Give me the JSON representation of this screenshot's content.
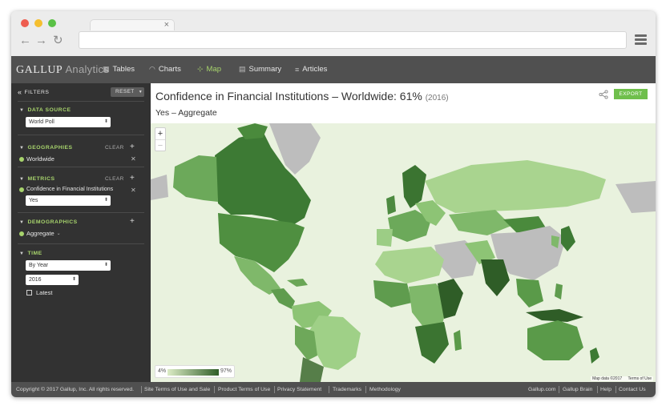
{
  "browser": {
    "tab_close": "×",
    "nav": {
      "back": "←",
      "forward": "→",
      "reload": "↻"
    }
  },
  "app": {
    "logo_brand": "GALLUP",
    "logo_sub": "Analytics",
    "nav_items": [
      {
        "label": "Tables",
        "icon": "table-icon"
      },
      {
        "label": "Charts",
        "icon": "chart-icon"
      },
      {
        "label": "Map",
        "icon": "map-icon",
        "active": true
      },
      {
        "label": "Summary",
        "icon": "summary-icon"
      },
      {
        "label": "Articles",
        "icon": "articles-icon"
      }
    ],
    "accent_color": "#a7d36c"
  },
  "sidebar": {
    "filters_label": "FILTERS",
    "reset_label": "RESET",
    "data_source": {
      "heading": "DATA SOURCE",
      "value": "World Poll"
    },
    "geographies": {
      "heading": "GEOGRAPHIES",
      "clear": "CLEAR",
      "item": "Worldwide"
    },
    "metrics": {
      "heading": "METRICS",
      "clear": "CLEAR",
      "item": "Confidence in Financial Institutions",
      "value": "Yes"
    },
    "demographics": {
      "heading": "DEMOGRAPHICS",
      "item": "Aggregate"
    },
    "time": {
      "heading": "TIME",
      "period": "By Year",
      "year": "2016",
      "latest_label": "Latest"
    }
  },
  "content": {
    "title": "Confidence in Financial Institutions – Worldwide:",
    "value": "61%",
    "year": "(2016)",
    "subtitle": "Yes – Aggregate",
    "export_label": "EXPORT"
  },
  "map": {
    "zoom_in": "+",
    "zoom_out": "−",
    "legend_min": "4%",
    "legend_max": "97%",
    "attribution": "Map data ©2017",
    "terms": "Terms of Use",
    "colors": {
      "ocean": "#e9f2de",
      "no_data": "#bdbdbd",
      "low": "#dcecc6",
      "high": "#2f5d27"
    }
  },
  "footer": {
    "copyright": "Copyright © 2017 Gallup, Inc. All rights reserved.",
    "links": [
      "Site Terms of Use and Sale",
      "Product Terms of Use",
      "Privacy Statement",
      "Trademarks",
      "Methodology"
    ],
    "right_links": [
      "Gallup.com",
      "Gallup Brain",
      "Help",
      "Contact Us"
    ]
  }
}
